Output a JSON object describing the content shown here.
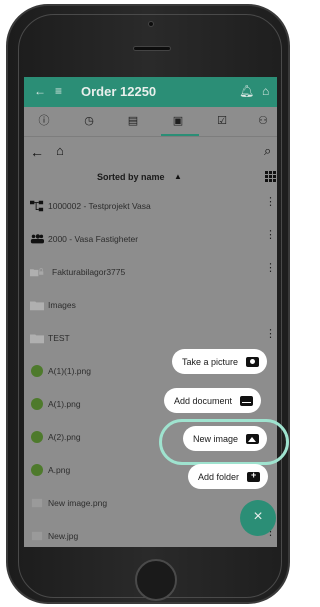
{
  "header": {
    "title": "Order 12250",
    "back_icon": "arrow-left-icon",
    "menu_icon": "hamburger-icon",
    "bell_icon": "bell-icon",
    "home_icon": "home-icon",
    "color": "#2b8e76"
  },
  "tabs": [
    {
      "icon": "info-icon",
      "glyph": "❶"
    },
    {
      "icon": "clock-icon",
      "glyph": "◷"
    },
    {
      "icon": "clipboard-icon",
      "glyph": "▤"
    },
    {
      "icon": "image-icon",
      "glyph": "▣",
      "active": true
    },
    {
      "icon": "checkbox-icon",
      "glyph": "☑"
    },
    {
      "icon": "users-icon",
      "glyph": "👥"
    }
  ],
  "nav": {
    "back_icon": "arrow-left-icon",
    "home_icon": "home-icon",
    "search_icon": "search-icon"
  },
  "sort": {
    "label": "Sorted by name",
    "arrow": "▲",
    "grid_icon": "grid-icon"
  },
  "list": [
    {
      "name": "1000002 - Testprojekt Vasa",
      "icon": "project-tree-icon"
    },
    {
      "name": "2000 - Vasa Fastigheter",
      "icon": "users-icon"
    },
    {
      "name": "Fakturabilagor3775",
      "icon": "folder-lock-icon"
    },
    {
      "name": "Images",
      "icon": "folder-icon"
    },
    {
      "name": "TEST",
      "icon": "folder-icon"
    },
    {
      "name": "A(1)(1).png",
      "icon": "image-thumb-icon"
    },
    {
      "name": "A(1).png",
      "icon": "image-thumb-icon"
    },
    {
      "name": "A(2).png",
      "icon": "image-thumb-icon"
    },
    {
      "name": "A.png",
      "icon": "image-thumb-icon"
    },
    {
      "name": "New image.png",
      "icon": "image-thumb-icon"
    },
    {
      "name": "New.jpg",
      "icon": "image-thumb-icon"
    }
  ],
  "fab_menu": {
    "take_picture": "Take a picture",
    "add_document": "Add document",
    "new_image": "New image",
    "add_folder": "Add folder",
    "close_glyph": "×"
  }
}
